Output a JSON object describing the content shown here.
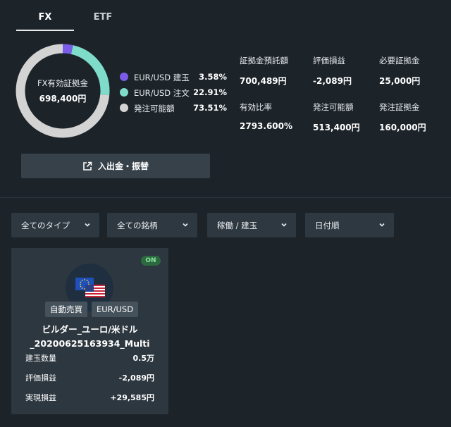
{
  "tabs": [
    {
      "label": "FX",
      "active": true
    },
    {
      "label": "ETF",
      "active": false
    }
  ],
  "donut": {
    "label": "FX有効証拠金",
    "value": "698,400円",
    "segments": [
      {
        "name": "EUR/USD 建玉",
        "percent": 3.58,
        "color": "#7b5ce8"
      },
      {
        "name": "EUR/USD 注文",
        "percent": 22.91,
        "color": "#7fdccb"
      },
      {
        "name": "発注可能額",
        "percent": 73.51,
        "color": "#d3d3d3"
      }
    ]
  },
  "legend": [
    {
      "label": "EUR/USD 建玉",
      "pct": "3.58%"
    },
    {
      "label": "EUR/USD 注文",
      "pct": "22.91%"
    },
    {
      "label": "発注可能額",
      "pct": "73.51%"
    }
  ],
  "stats": [
    {
      "label": "証拠金預託額",
      "value": "700,489円"
    },
    {
      "label": "評価損益",
      "value": "-2,089円"
    },
    {
      "label": "必要証拠金",
      "value": "25,000円"
    },
    {
      "label": "有効比率",
      "value": "2793.600%"
    },
    {
      "label": "発注可能額",
      "value": "513,400円"
    },
    {
      "label": "発注証拠金",
      "value": "160,000円"
    }
  ],
  "deposit_button": {
    "label": "入出金・振替",
    "icon": "external-link-icon"
  },
  "filters": [
    {
      "label": "全てのタイプ"
    },
    {
      "label": "全ての銘柄"
    },
    {
      "label": "稼働 / 建玉"
    },
    {
      "label": "日付順"
    }
  ],
  "card": {
    "status": "ON",
    "flag_icon": "eu-us-flag-icon",
    "tags": [
      "自動売買",
      "EUR/USD"
    ],
    "name_line1": "ビルダー_ユーロ/米ドル",
    "name_line2": "_20200625163934_Multi",
    "rows": [
      {
        "label": "建玉数量",
        "value": "0.5万"
      },
      {
        "label": "評価損益",
        "value": "-2,089円"
      },
      {
        "label": "実現損益",
        "value": "+29,585円"
      }
    ]
  }
}
